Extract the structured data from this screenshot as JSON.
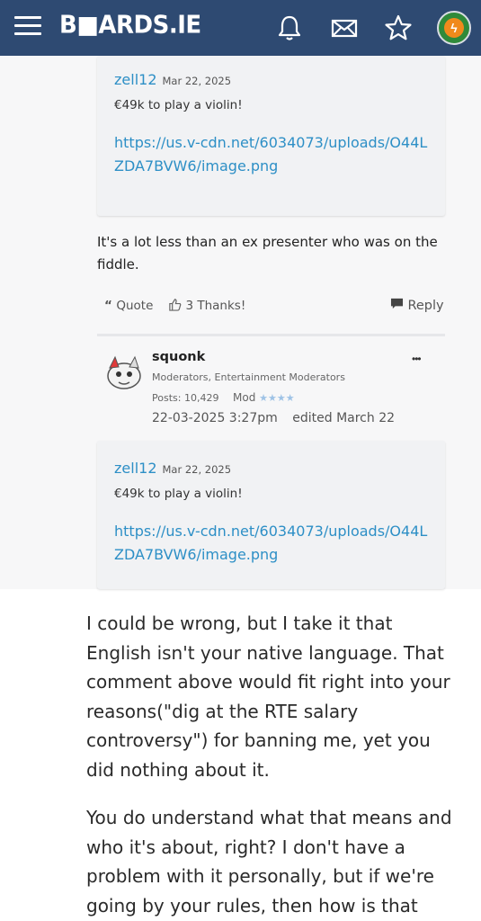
{
  "header": {
    "logo_text": "B■ARDS.IE",
    "menu_icon": "hamburger-menu-icon",
    "bell_icon": "bell-icon",
    "mail_icon": "envelope-icon",
    "star_icon": "star-icon",
    "avatar_glyph": "ϟ",
    "bg_color": "#2e4a72"
  },
  "post1": {
    "quote": {
      "user": "zell12",
      "date": "Mar 22, 2025",
      "text": "€49k to play a violin!",
      "link": "https://us.v-cdn.net/6034073/uploads/O44LZDA7BVW6/image.png"
    },
    "body": "It's a lot less than an ex presenter who was on the fiddle.",
    "actions": {
      "quote_label": "Quote",
      "thanks_label": "3 Thanks!",
      "reply_label": "Reply"
    }
  },
  "post2": {
    "author": "squonk",
    "roles": "Moderators, Entertainment Moderators",
    "posts": "Posts: 10,429",
    "rank": "Mod",
    "rank_stars": "★★★★",
    "datetime": "22-03-2025 3:27pm",
    "edited": "edited March 22",
    "more": "•••",
    "quote": {
      "user": "zell12",
      "date": "Mar 22, 2025",
      "text": "€49k to play a violin!",
      "link": "https://us.v-cdn.net/6034073/uploads/O44LZDA7BVW6/image.png"
    }
  },
  "reply_text": {
    "p1": "I could be wrong, but I take it that English isn't your native language. That comment above would fit right into your reasons(\"dig at the RTE salary controversy\") for banning me, yet you did nothing about it.",
    "p2": "You do understand what that means and who it's about, right? I don't have a problem with it personally, but if we're going by your rules, then how is that"
  },
  "colors": {
    "link": "#2d8fc6",
    "star": "#9fc3e6"
  }
}
